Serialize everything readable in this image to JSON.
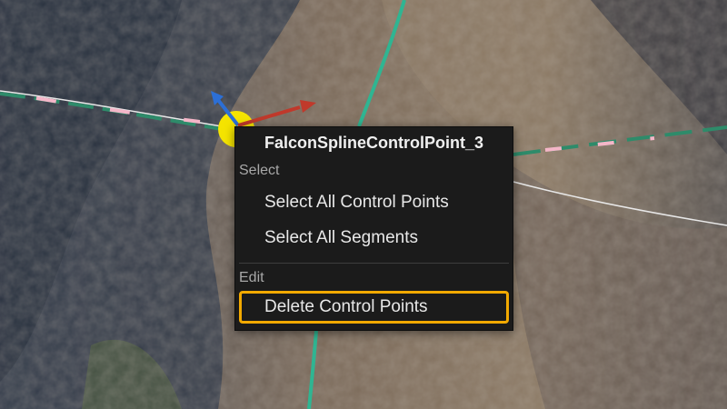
{
  "context_menu": {
    "title": "FalconSplineControlPoint_3",
    "sections": [
      {
        "header": "Select",
        "items": [
          "Select All Control Points",
          "Select All Segments"
        ]
      },
      {
        "header": "Edit",
        "items": [
          "Delete Control Points"
        ]
      }
    ],
    "highlight_color": "#f2a900"
  },
  "viewport": {
    "gizmo_icons": [
      "translate-x-arrow-icon",
      "translate-z-arrow-icon",
      "control-point-handle-icon"
    ],
    "spline_colors": [
      "#2e8b6a",
      "#f4b6c8",
      "#ffffff",
      "#2fb592"
    ]
  }
}
